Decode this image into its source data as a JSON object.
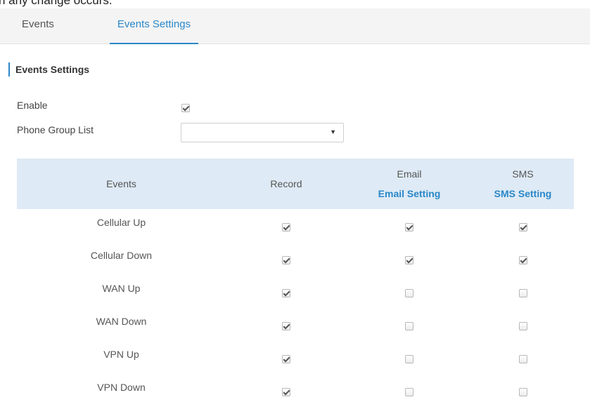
{
  "tabs": [
    {
      "label": "Events",
      "active": false
    },
    {
      "label": "Events Settings",
      "active": true
    }
  ],
  "section_title": "Events Settings",
  "form": {
    "enable_label": "Enable",
    "enable_checked": true,
    "phone_group_label": "Phone Group List",
    "phone_group_value": ""
  },
  "table": {
    "headers": {
      "events": "Events",
      "record": "Record",
      "email": "Email",
      "email_link": "Email Setting",
      "sms": "SMS",
      "sms_link": "SMS Setting"
    },
    "rows": [
      {
        "event": "Cellular Up",
        "record": true,
        "email": true,
        "sms": true
      },
      {
        "event": "Cellular Down",
        "record": true,
        "email": true,
        "sms": true
      },
      {
        "event": "WAN Up",
        "record": true,
        "email": false,
        "sms": false
      },
      {
        "event": "WAN Down",
        "record": true,
        "email": false,
        "sms": false
      },
      {
        "event": "VPN Up",
        "record": true,
        "email": false,
        "sms": false
      },
      {
        "event": "VPN Down",
        "record": true,
        "email": false,
        "sms": false
      }
    ]
  },
  "colors": {
    "accent": "#2a87c8",
    "header_bg": "#deeaf5",
    "tabbar_bg": "#f4f4f4"
  }
}
